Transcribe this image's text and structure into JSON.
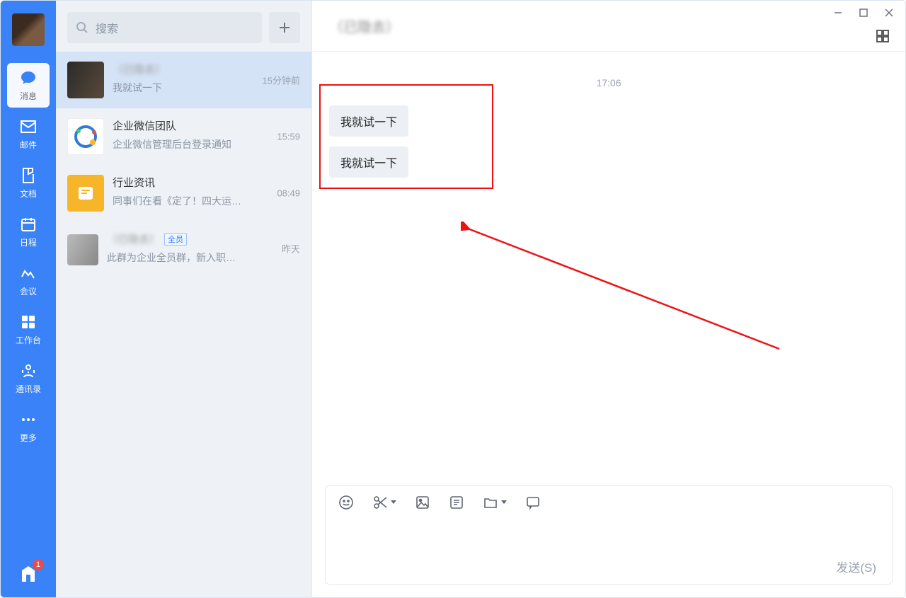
{
  "rail": {
    "items": [
      {
        "label": "消息",
        "icon": "chat-bubble-icon"
      },
      {
        "label": "邮件",
        "icon": "mail-icon"
      },
      {
        "label": "文档",
        "icon": "doc-icon"
      },
      {
        "label": "日程",
        "icon": "calendar-icon"
      },
      {
        "label": "会议",
        "icon": "meeting-icon"
      },
      {
        "label": "工作台",
        "icon": "apps-icon"
      },
      {
        "label": "通讯录",
        "icon": "contacts-icon"
      },
      {
        "label": "更多",
        "icon": "more-icon"
      }
    ],
    "bottom_badge": "1"
  },
  "search": {
    "placeholder": "搜索"
  },
  "conversations": [
    {
      "name": "（已隐去）",
      "preview": "我就试一下",
      "time": "15分钟前",
      "name_blur": true
    },
    {
      "name": "企业微信团队",
      "preview": "企业微信管理后台登录通知",
      "time": "15:59"
    },
    {
      "name": "行业资讯",
      "preview": "同事们在看《定了！四大运…",
      "time": "08:49"
    },
    {
      "name": "（已隐去）",
      "preview": "此群为企业全员群，新入职…",
      "time": "昨天",
      "tag": "全员",
      "name_blur": true,
      "small_avatar": true
    }
  ],
  "chat": {
    "title": "（已隐去）",
    "timestamp": "17:06",
    "messages": [
      "我就试一下",
      "我就试一下"
    ],
    "send_label": "发送(S)"
  },
  "annotation": {
    "type": "highlight-box-with-arrow"
  }
}
